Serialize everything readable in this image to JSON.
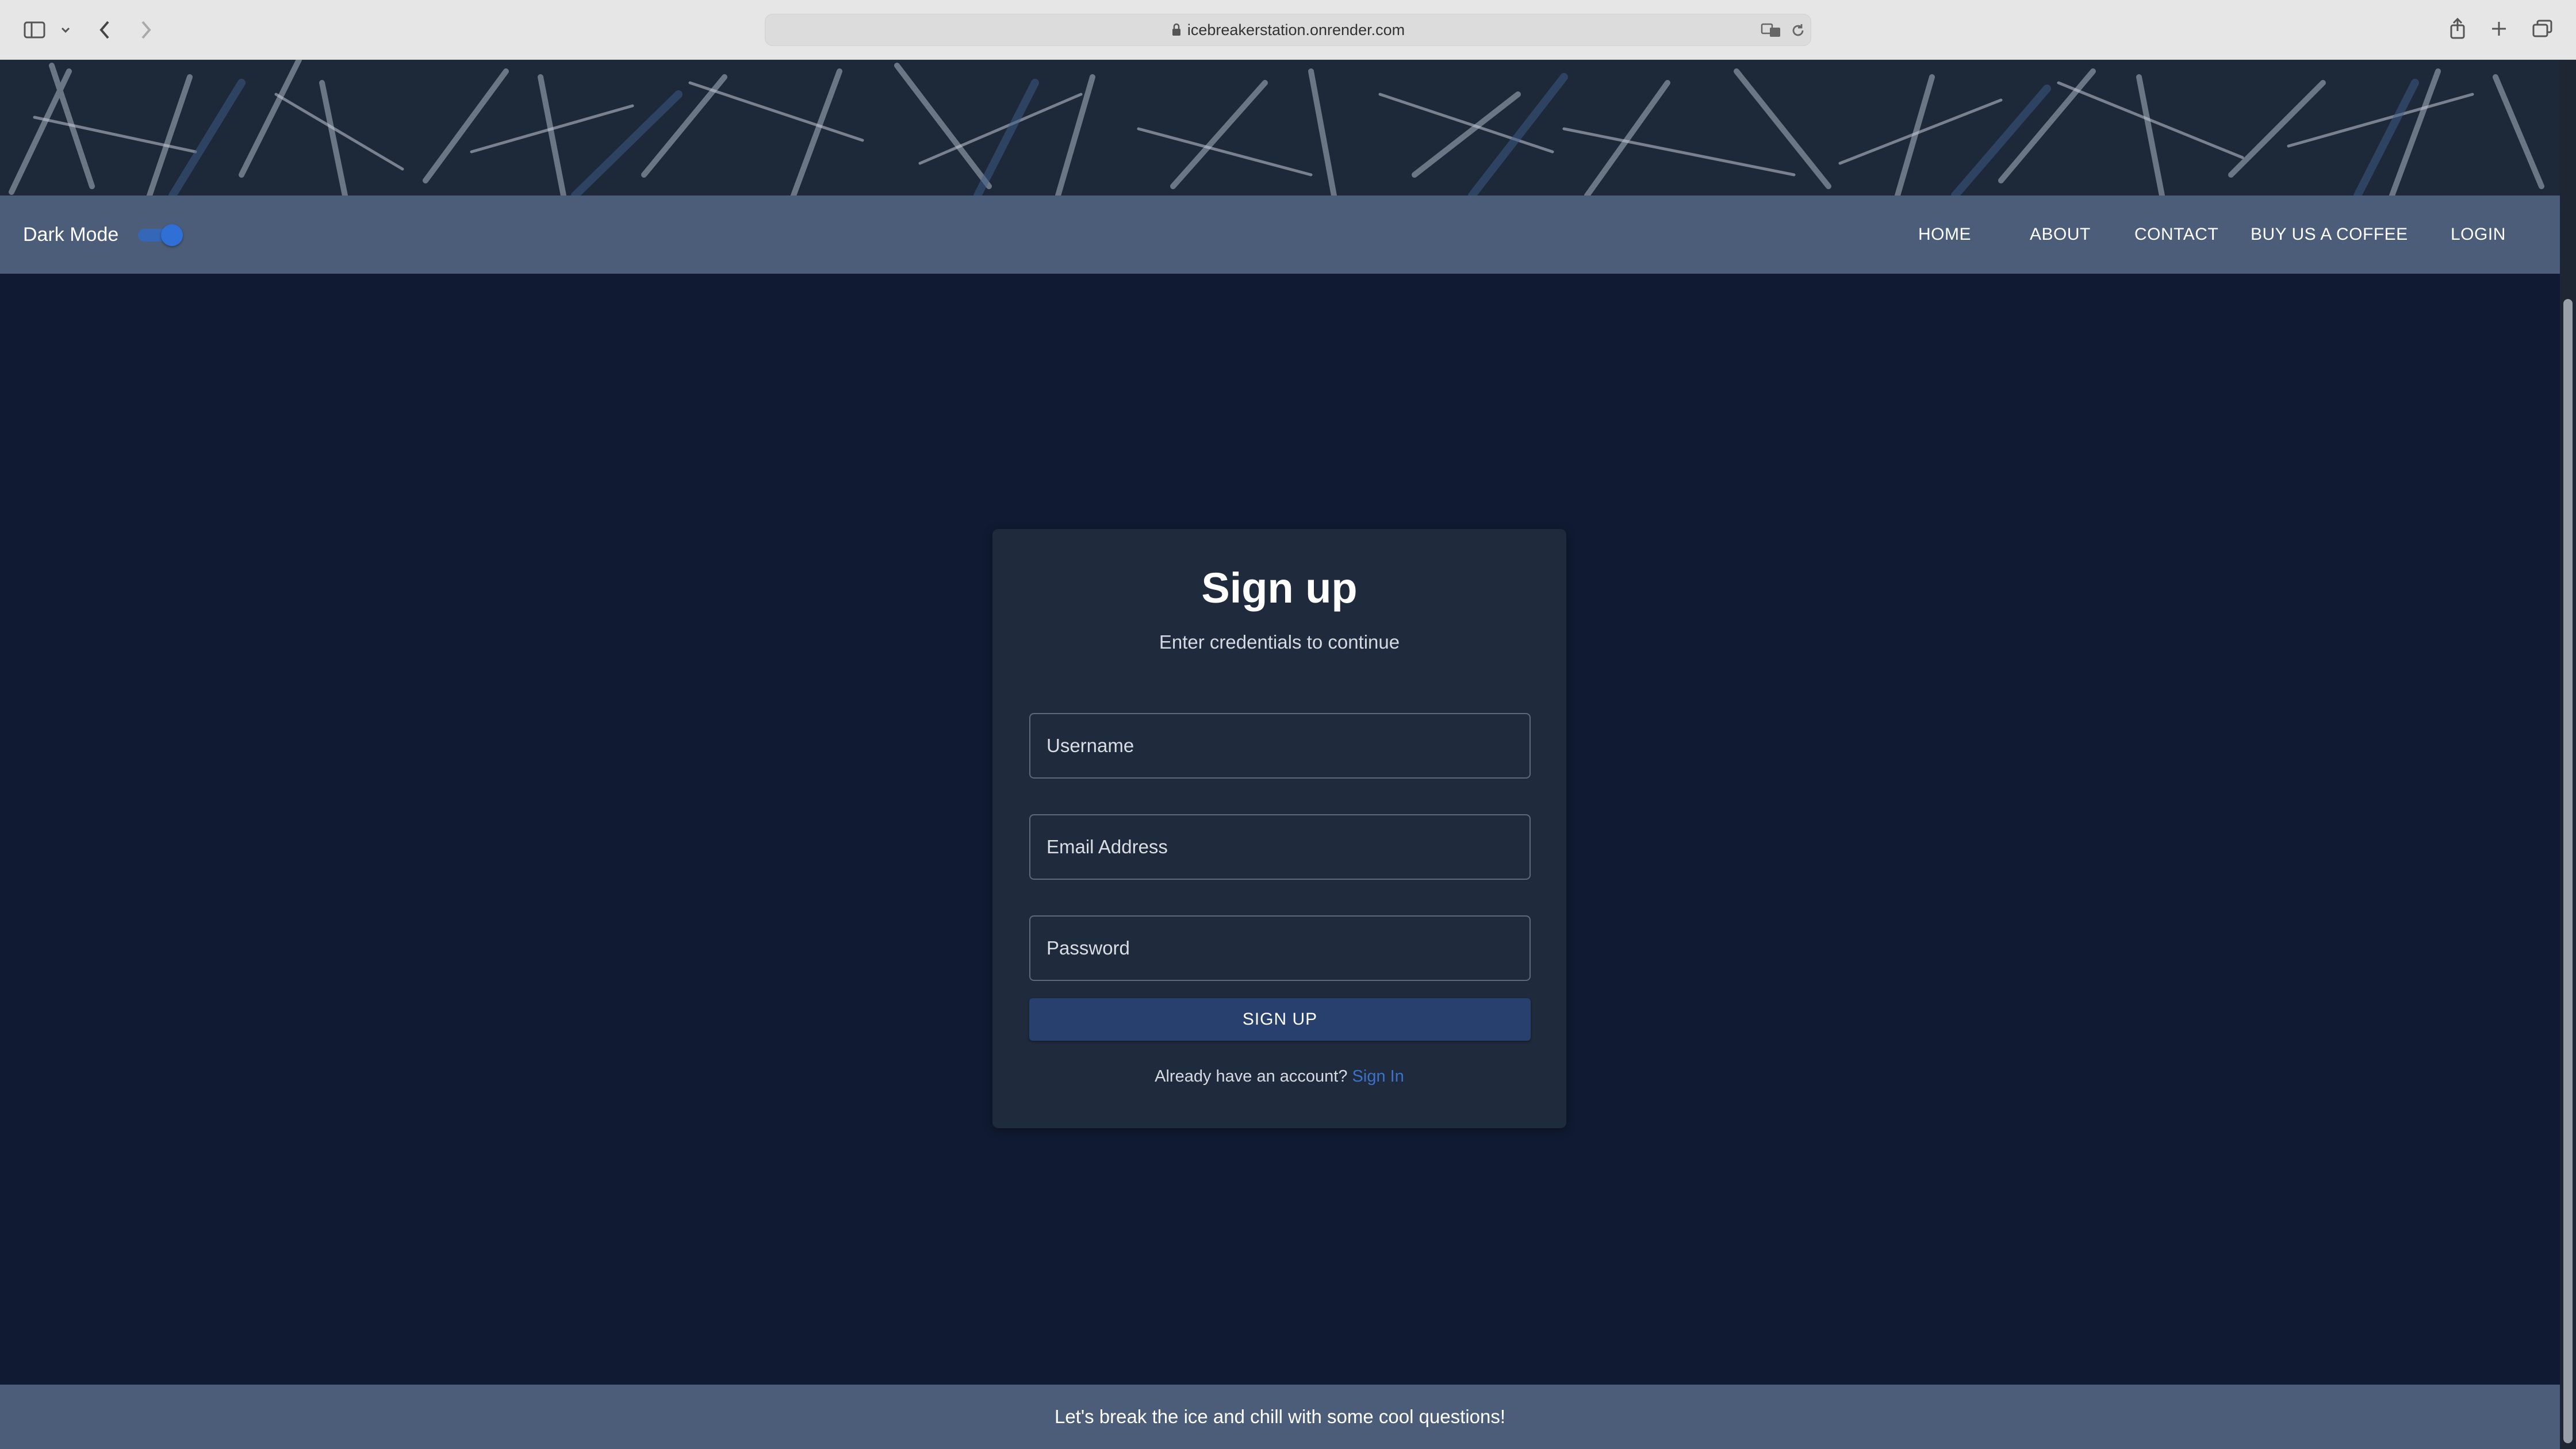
{
  "browser": {
    "url": "icebreakerstation.onrender.com"
  },
  "navbar": {
    "dark_mode_label": "Dark Mode",
    "dark_mode_on": true,
    "items": [
      {
        "label": "HOME"
      },
      {
        "label": "ABOUT"
      },
      {
        "label": "CONTACT"
      },
      {
        "label": "BUY US A COFFEE"
      },
      {
        "label": "LOGIN"
      }
    ]
  },
  "signup": {
    "title": "Sign up",
    "subtitle": "Enter credentials to continue",
    "username_placeholder": "Username",
    "email_placeholder": "Email Address",
    "password_placeholder": "Password",
    "submit_label": "SIGN UP",
    "signin_prompt": "Already have an account?",
    "signin_link": "Sign In"
  },
  "footer": {
    "text": "Let's break the ice and chill with some cool questions!"
  },
  "colors": {
    "page_bg": "#101a32",
    "navbar_bg": "#4b5d79",
    "card_bg": "#1f2a3c",
    "button_bg": "#27406e",
    "link": "#3a72c9",
    "toggle": "#2f6fd6"
  }
}
